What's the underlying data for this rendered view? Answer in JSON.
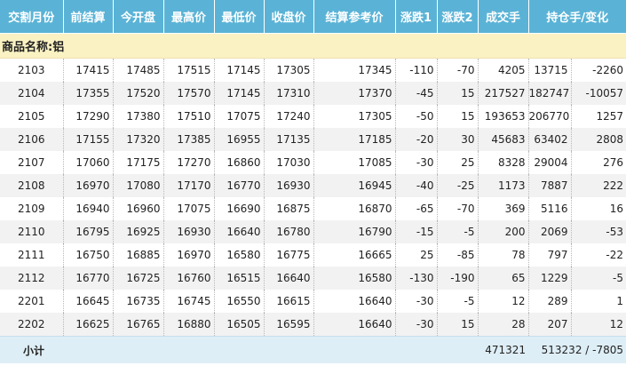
{
  "headers": [
    "交割月份",
    "前结算",
    "今开盘",
    "最高价",
    "最低价",
    "收盘价",
    "结算参考价",
    "涨跌1",
    "涨跌2",
    "成交手",
    "持仓手/变化"
  ],
  "section": {
    "label": "商品名称:铝"
  },
  "rows": [
    [
      "2103",
      "17415",
      "17485",
      "17515",
      "17145",
      "17305",
      "17345",
      "-110",
      "-70",
      "4205",
      "13715",
      "-2260"
    ],
    [
      "2104",
      "17355",
      "17520",
      "17570",
      "17145",
      "17310",
      "17370",
      "-45",
      "15",
      "217527",
      "182747",
      "-10057"
    ],
    [
      "2105",
      "17290",
      "17380",
      "17510",
      "17075",
      "17240",
      "17305",
      "-50",
      "15",
      "193653",
      "206770",
      "1257"
    ],
    [
      "2106",
      "17155",
      "17320",
      "17385",
      "16955",
      "17135",
      "17185",
      "-20",
      "30",
      "45683",
      "63402",
      "2808"
    ],
    [
      "2107",
      "17060",
      "17175",
      "17270",
      "16860",
      "17030",
      "17085",
      "-30",
      "25",
      "8328",
      "29004",
      "276"
    ],
    [
      "2108",
      "16970",
      "17080",
      "17170",
      "16770",
      "16930",
      "16945",
      "-40",
      "-25",
      "1173",
      "7887",
      "222"
    ],
    [
      "2109",
      "16940",
      "16960",
      "17075",
      "16690",
      "16875",
      "16870",
      "-65",
      "-70",
      "369",
      "5116",
      "16"
    ],
    [
      "2110",
      "16795",
      "16925",
      "16930",
      "16640",
      "16780",
      "16790",
      "-15",
      "-5",
      "200",
      "2069",
      "-53"
    ],
    [
      "2111",
      "16750",
      "16885",
      "16970",
      "16580",
      "16775",
      "16665",
      "25",
      "-85",
      "78",
      "797",
      "-22"
    ],
    [
      "2112",
      "16770",
      "16725",
      "16760",
      "16515",
      "16640",
      "16580",
      "-130",
      "-190",
      "65",
      "1229",
      "-5"
    ],
    [
      "2201",
      "16645",
      "16735",
      "16745",
      "16550",
      "16615",
      "16640",
      "-30",
      "-5",
      "12",
      "289",
      "1"
    ],
    [
      "2202",
      "16625",
      "16765",
      "16880",
      "16505",
      "16595",
      "16640",
      "-30",
      "15",
      "28",
      "207",
      "12"
    ]
  ],
  "footer": {
    "label": "小计",
    "volume": "471321",
    "open_interest": "513232 / -7805"
  },
  "colors": {
    "header_bg": "#5ab3d6",
    "section_bg": "#fbf2c3",
    "footer_bg": "#deeef6",
    "stripe": "#f2f2f2"
  }
}
